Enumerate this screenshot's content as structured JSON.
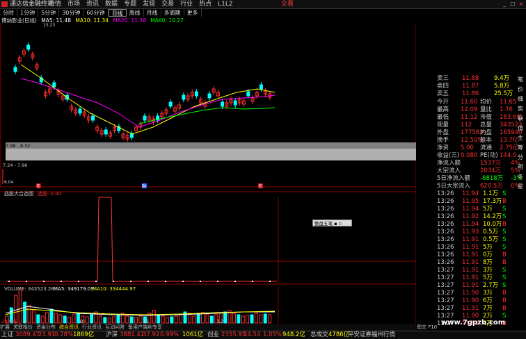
{
  "window": {
    "app_title": "通达信金融终端",
    "menu": [
      "行情",
      "市场",
      "资讯",
      "数据",
      "专题",
      "发现",
      "交易",
      "行业",
      "热点",
      "L1L2"
    ],
    "trade_label": "交易",
    "controls": [
      "_",
      "□",
      "×"
    ]
  },
  "period_tabs": {
    "items": [
      "分时",
      "1分钟",
      "5分钟",
      "30分钟",
      "60分钟",
      "日线",
      "周线",
      "月线",
      "多周期",
      "更多"
    ],
    "selected": "日线"
  },
  "stock": {
    "name_label": "博纳影业(日线)",
    "ma5": "MA5: 11.48",
    "ma10": "MA10: 11.34",
    "ma20": "MA20: 11.38",
    "ma60": "MA60: 10.27"
  },
  "price_chart": {
    "high_mark": "15.23",
    "low_mark": "6.04",
    "axis_ticks": [
      "12.00",
      "11.00",
      "10.00",
      "9.00",
      "8.00",
      "7.00"
    ],
    "band1_label": "7.98 - 8.32",
    "band2_label": "7.24 - 7.96",
    "x_labels": [
      "9",
      "10",
      "11",
      "12"
    ],
    "flags": [
      "信",
      "财",
      "信"
    ]
  },
  "indicator_pane": {
    "label": "品股大合选图",
    "value_label": "选股: 0.00",
    "axis_ticks": [
      "0.80",
      "0.60",
      "0.40",
      "0.20",
      "0.00"
    ]
  },
  "volume_pane": {
    "label": "VOLUME: 343523.28",
    "ma5": "MA5: 349179.09",
    "ma10": "MA10: 334444.97",
    "axis_ticks": [
      "20000",
      "15000",
      "10000",
      "5000",
      "X10"
    ],
    "year_label": "2022年"
  },
  "popup": {
    "label": "整盘五笔"
  },
  "quote_panel": {
    "asks": [
      {
        "label": "卖三",
        "price": "11.88",
        "vol": "9.4万"
      },
      {
        "label": "卖四",
        "price": "11.87",
        "vol": "5.8万"
      },
      {
        "label": "卖五",
        "price": "11.86",
        "vol": "25.5万"
      }
    ],
    "stats": [
      {
        "l1": "今开",
        "v1": "11.60",
        "l2": "均价",
        "v2": "11.65"
      },
      {
        "l1": "最高",
        "v1": "12.09",
        "l2": "量比",
        "v2": "1.76"
      },
      {
        "l1": "最低",
        "v1": "11.12",
        "l2": "市值",
        "v2": "163.6亿"
      },
      {
        "l1": "现量",
        "v1": "112",
        "l2": "总量",
        "v2": "343523"
      },
      {
        "l1": "外盘",
        "v1": "177583",
        "l2": "内盘",
        "v2": "165940"
      },
      {
        "l1": "换手",
        "v1": "12.50%",
        "l2": "股本",
        "v2": "13.7亿"
      },
      {
        "l1": "净资",
        "v1": "5.00",
        "l2": "流通",
        "v2": "2.75亿"
      },
      {
        "l1": "收益(三)",
        "v1": "0.080",
        "l2": "PE(动)",
        "v2": "144.0"
      }
    ],
    "flows": [
      {
        "label": "净流入额",
        "value": "1537万",
        "pct": "4%"
      },
      {
        "label": "大宗流入",
        "value": "2034万",
        "pct": "5%"
      },
      {
        "label": "5日净流入额",
        "value": "-6818万",
        "pct": "-3%"
      },
      {
        "label": "5日大宗流入",
        "value": "620.5万",
        "pct": "0%"
      }
    ],
    "ticks": [
      {
        "time": "13:26",
        "price": "11.94",
        "vol": "1.1万",
        "dir": "S"
      },
      {
        "time": "13:26",
        "price": "11.95",
        "vol": "17.3万",
        "dir": "B"
      },
      {
        "time": "13:26",
        "price": "11.94",
        "vol": "5万",
        "dir": "S"
      },
      {
        "time": "13:26",
        "price": "11.92",
        "vol": "14.2万",
        "dir": "S"
      },
      {
        "time": "13:26",
        "price": "11.94",
        "vol": "10.0万",
        "dir": "B"
      },
      {
        "time": "13:26",
        "price": "11.93",
        "vol": "0.5万",
        "dir": "S"
      },
      {
        "time": "13:26",
        "price": "11.91",
        "vol": "0.5万",
        "dir": "S"
      },
      {
        "time": "13:26",
        "price": "11.91",
        "vol": "5万",
        "dir": "S"
      },
      {
        "time": "13:26",
        "price": "11.91",
        "vol": "0万",
        "dir": "B"
      },
      {
        "time": "13:26",
        "price": "11.91",
        "vol": "8万",
        "dir": "B"
      },
      {
        "time": "13:27",
        "price": "11.91",
        "vol": "3万",
        "dir": "S"
      },
      {
        "time": "13:27",
        "price": "11.91",
        "vol": "5万",
        "dir": "S"
      },
      {
        "time": "13:27",
        "price": "11.91",
        "vol": "2.7万",
        "dir": "S"
      },
      {
        "time": "13:27",
        "price": "11.90",
        "vol": "3万",
        "dir": "B"
      },
      {
        "time": "13:27",
        "price": "11.90",
        "vol": "6万",
        "dir": "B"
      },
      {
        "time": "13:27",
        "price": "11.91",
        "vol": "7万",
        "dir": "B"
      },
      {
        "time": "13:27",
        "price": "11.90",
        "vol": "2万",
        "dir": "S"
      },
      {
        "time": "13:27",
        "price": "11.91",
        "vol": "4万",
        "dir": "B"
      }
    ]
  },
  "side_tabs": [
    "笔",
    "价",
    "细",
    "势",
    "联",
    "值",
    "主",
    "筹",
    "分",
    "明",
    "多",
    "星"
  ],
  "bottom_tabs": {
    "items": [
      "指标",
      "窗口",
      "MACD",
      "VOL-TDX",
      "CCI",
      "趋势动力",
      "主力监控",
      "私募主图",
      "MA2",
      "测试主图",
      "测试幅图A",
      "测试幅图B",
      "更多",
      "设置"
    ],
    "selected": "测试主图"
  },
  "quick_links": [
    "扩展",
    "关联报价",
    "资金分布",
    "综合资讯",
    "行业资讯",
    "互动问答",
    "备用户端利专享"
  ],
  "right_labels": {
    "model": "模板",
    "fund": "图文 F10",
    "market": "本地"
  },
  "status": [
    {
      "name": "上证",
      "value": "3089.47",
      "chg": "23.91",
      "pct": "0.78%",
      "amt": "1869亿"
    },
    {
      "name": "沪深",
      "value": "3881.41",
      "chg": "37.92",
      "pct": "0.99%",
      "amt": "1061亿"
    },
    {
      "name": "创业",
      "value": "2355.95",
      "chg": "24.54",
      "pct": "1.05%",
      "amt": "948.2亿"
    },
    {
      "name": "总成交",
      "value": "",
      "chg": "",
      "pct": "",
      "amt": "4786亿"
    }
  ],
  "status_right": "平安证券福州行情",
  "watermark": "www.7gpzb.com",
  "colors": {
    "up": "#ff3030",
    "down": "#00ffff",
    "ma5": "#ffffff",
    "ma10": "#ffff00",
    "ma20": "#ff00ff",
    "ma60": "#00ff00",
    "frame": "#8a0000"
  }
}
